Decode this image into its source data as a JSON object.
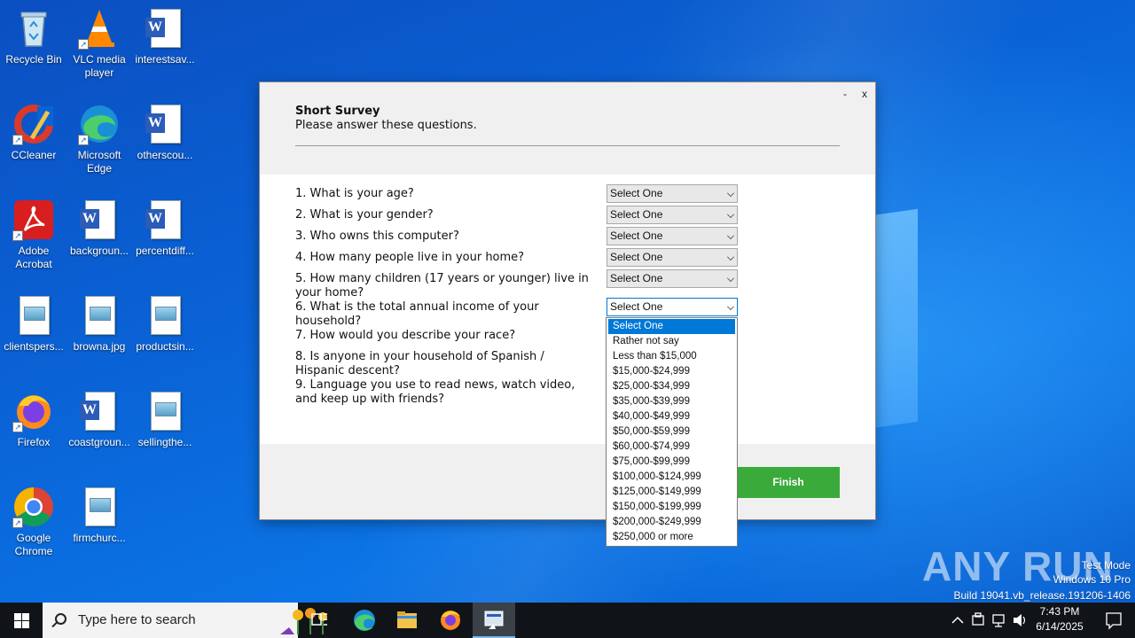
{
  "desktop_icons": [
    {
      "label": "Recycle Bin",
      "icon": "recycle-bin-icon"
    },
    {
      "label": "VLC media player",
      "icon": "vlc-icon"
    },
    {
      "label": "interestsav...",
      "icon": "word-doc-icon"
    },
    {
      "label": "CCleaner",
      "icon": "ccleaner-icon"
    },
    {
      "label": "Microsoft Edge",
      "icon": "edge-icon"
    },
    {
      "label": "otherscou...",
      "icon": "word-doc-icon"
    },
    {
      "label": "Adobe Acrobat",
      "icon": "acrobat-icon"
    },
    {
      "label": "backgroun...",
      "icon": "word-doc-icon"
    },
    {
      "label": "percentdiff...",
      "icon": "word-doc-icon"
    },
    {
      "label": "clientspers...",
      "icon": "image-file-icon"
    },
    {
      "label": "browna.jpg",
      "icon": "image-file-icon"
    },
    {
      "label": "productsin...",
      "icon": "image-file-icon"
    },
    {
      "label": "Firefox",
      "icon": "firefox-icon"
    },
    {
      "label": "coastgroun...",
      "icon": "word-doc-icon"
    },
    {
      "label": "sellingthe...",
      "icon": "image-file-icon"
    },
    {
      "label": "Google Chrome",
      "icon": "chrome-icon"
    },
    {
      "label": "firmchurc...",
      "icon": "image-file-icon"
    }
  ],
  "dialog": {
    "minimize": "-",
    "close": "x",
    "title": "Short Survey",
    "subtitle": "Please answer these questions.",
    "questions": [
      {
        "text": "1. What is your age?",
        "value": "Select One"
      },
      {
        "text": "2. What is your gender?",
        "value": "Select One"
      },
      {
        "text": "3. Who owns this computer?",
        "value": "Select One"
      },
      {
        "text": "4. How many people live in your home?",
        "value": "Select One"
      },
      {
        "text": "5. How many children (17 years or younger) live in",
        "text2": "your home?",
        "value": "Select One"
      },
      {
        "text": "6. What is the total annual income of your",
        "text2": "household?",
        "value": "Select One"
      },
      {
        "text": "7. How would you describe your race?"
      },
      {
        "text": "8. Is anyone in your household of Spanish /",
        "text2": "Hispanic descent?"
      },
      {
        "text": "9. Language you use to read news, watch video,",
        "text2": "and keep up with friends?"
      }
    ],
    "finish_label": "Finish"
  },
  "dropdown_options": [
    "Select One",
    "Rather not say",
    "Less than $15,000",
    "$15,000-$24,999",
    "$25,000-$34,999",
    "$35,000-$39,999",
    "$40,000-$49,999",
    "$50,000-$59,999",
    "$60,000-$74,999",
    "$75,000-$99,999",
    "$100,000-$124,999",
    "$125,000-$149,999",
    "$150,000-$199,999",
    "$200,000-$249,999",
    "$250,000 or more"
  ],
  "watermark": {
    "logo": "ANY RUN",
    "line1": "Test Mode",
    "line2": "Windows 10 Pro",
    "line3": "Build 19041.vb_release.191206-1406"
  },
  "taskbar": {
    "search_placeholder": "Type here to search",
    "time": "7:43 PM",
    "date": "6/14/2025"
  },
  "colors": {
    "finish_green": "#3aaa3a",
    "selection_blue": "#0078d7",
    "desktop_blue": "#0a5fcf"
  }
}
